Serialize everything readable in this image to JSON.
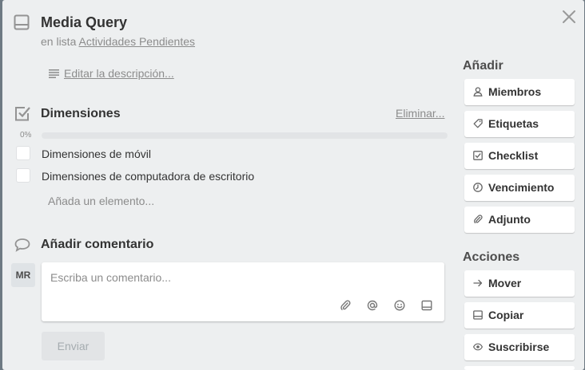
{
  "card": {
    "title": "Media Query",
    "list_prefix": "en lista",
    "list_name": "Actividades Pendientes",
    "edit_description": "Editar la descripción..."
  },
  "checklist": {
    "title": "Dimensiones",
    "delete_label": "Eliminar...",
    "progress_label": "0%",
    "progress_value": 0,
    "items": [
      {
        "label": "Dimensiones de móvil",
        "checked": false
      },
      {
        "label": "Dimensiones de computadora de escritorio",
        "checked": false
      }
    ],
    "add_item": "Añada un elemento..."
  },
  "comment": {
    "title": "Añadir comentario",
    "avatar_initials": "MR",
    "placeholder": "Escriba un comentario...",
    "send_label": "Enviar"
  },
  "sidebar": {
    "add_heading": "Añadir",
    "add_buttons": [
      {
        "label": "Miembros",
        "icon": "member-icon"
      },
      {
        "label": "Etiquetas",
        "icon": "label-icon"
      },
      {
        "label": "Checklist",
        "icon": "checklist-icon"
      },
      {
        "label": "Vencimiento",
        "icon": "clock-icon"
      },
      {
        "label": "Adjunto",
        "icon": "attachment-icon"
      }
    ],
    "actions_heading": "Acciones",
    "action_buttons": [
      {
        "label": "Mover",
        "icon": "arrow-right-icon"
      },
      {
        "label": "Copiar",
        "icon": "copy-icon"
      },
      {
        "label": "Suscribirse",
        "icon": "eye-icon"
      }
    ]
  },
  "colors": {
    "modal_bg": "#edeff0",
    "button_bg": "#ffffff",
    "send_disabled_bg": "#e2e4e6",
    "progress_track": "#e2e4e6"
  }
}
